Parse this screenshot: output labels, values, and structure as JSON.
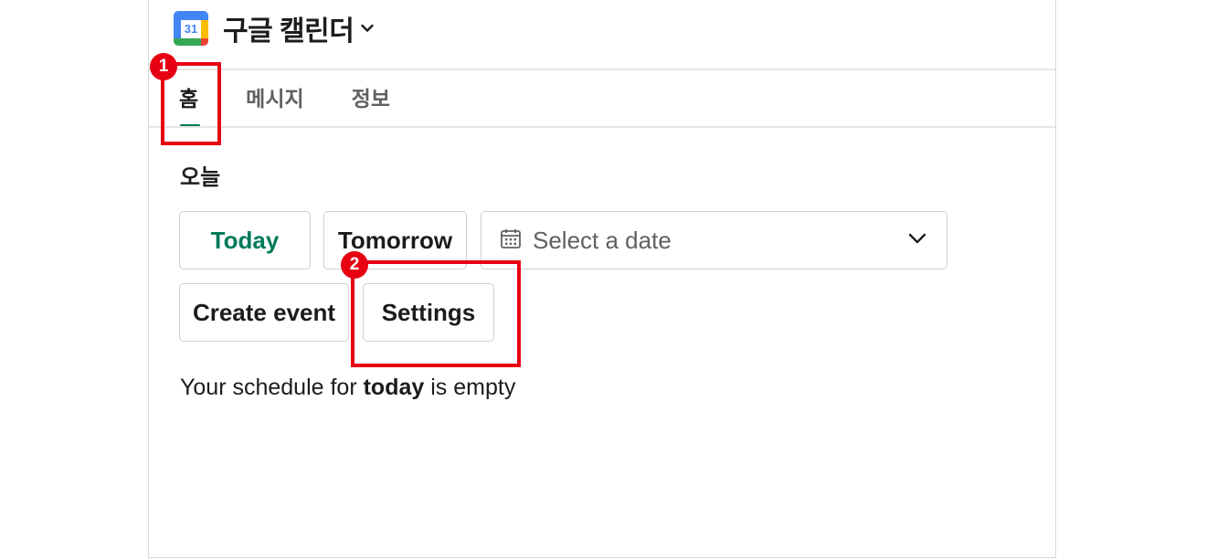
{
  "app": {
    "title": "구글 캘린더",
    "icon_day": "31",
    "icon": "google-calendar-icon"
  },
  "tabs": [
    {
      "label": "홈",
      "active": true
    },
    {
      "label": "메시지",
      "active": false
    },
    {
      "label": "정보",
      "active": false
    }
  ],
  "home": {
    "section_title": "오늘",
    "today_button": "Today",
    "tomorrow_button": "Tomorrow",
    "date_select": {
      "placeholder": "Select a date"
    },
    "create_event_button": "Create event",
    "settings_button": "Settings",
    "empty_prefix": "Your schedule for ",
    "empty_bold": "today",
    "empty_suffix": " is empty"
  },
  "annotations": [
    {
      "number": "1",
      "target": "tab-home"
    },
    {
      "number": "2",
      "target": "settings-button"
    }
  ],
  "colors": {
    "accent_green": "#007a5a",
    "annotation_red": "#e60012",
    "border": "#cfcfcf"
  }
}
